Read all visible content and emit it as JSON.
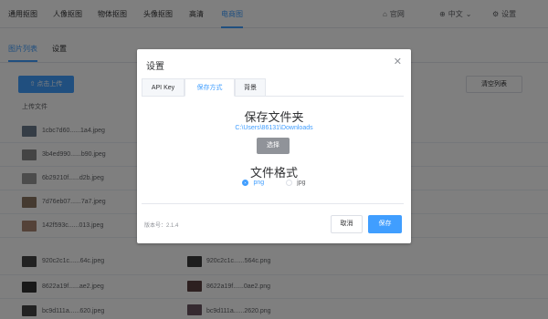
{
  "nav": {
    "items": [
      "通用抠图",
      "人像抠图",
      "物体抠图",
      "头像抠图",
      "高清",
      "电商图"
    ],
    "active_index": 5,
    "website": "官网",
    "language": "中文",
    "settings": "设置"
  },
  "subtabs": [
    "图片列表",
    "设置"
  ],
  "toolbar": {
    "upload": "点击上传",
    "clear": "清空列表"
  },
  "list": {
    "header": "上传文件",
    "rows": [
      {
        "left": "1cbc7d60......1a4.jpeg"
      },
      {
        "left": "3b4ed990......b90.jpeg"
      },
      {
        "left": "6b29210f......d2b.jpeg"
      },
      {
        "left": "7d76eb07......7a7.jpeg"
      },
      {
        "left": "142f593c......013.jpeg"
      },
      {
        "left": "920c2c1c......64c.jpeg",
        "right": "920c2c1c......564c.png"
      },
      {
        "left": "8622a19f......ae2.jpeg",
        "right": "8622a19f......0ae2.png"
      },
      {
        "left": "bc9d111a......620.jpeg",
        "right": "bc9d111a......2620.png"
      }
    ]
  },
  "dialog": {
    "title": "设置",
    "tabs": [
      "API Key",
      "保存方式",
      "背景"
    ],
    "active_tab": 1,
    "save_folder_title": "保存文件夹",
    "path": "C:\\Users\\86131\\Downloads",
    "choose": "选择",
    "format_title": "文件格式",
    "formats": [
      "png",
      "jpg"
    ],
    "selected_format": "png",
    "version": "版本号：2.1.4",
    "cancel": "取消",
    "save": "保存"
  },
  "colors": {
    "accent": "#409eff",
    "overlay": "rgba(0,0,0,0.5)"
  }
}
